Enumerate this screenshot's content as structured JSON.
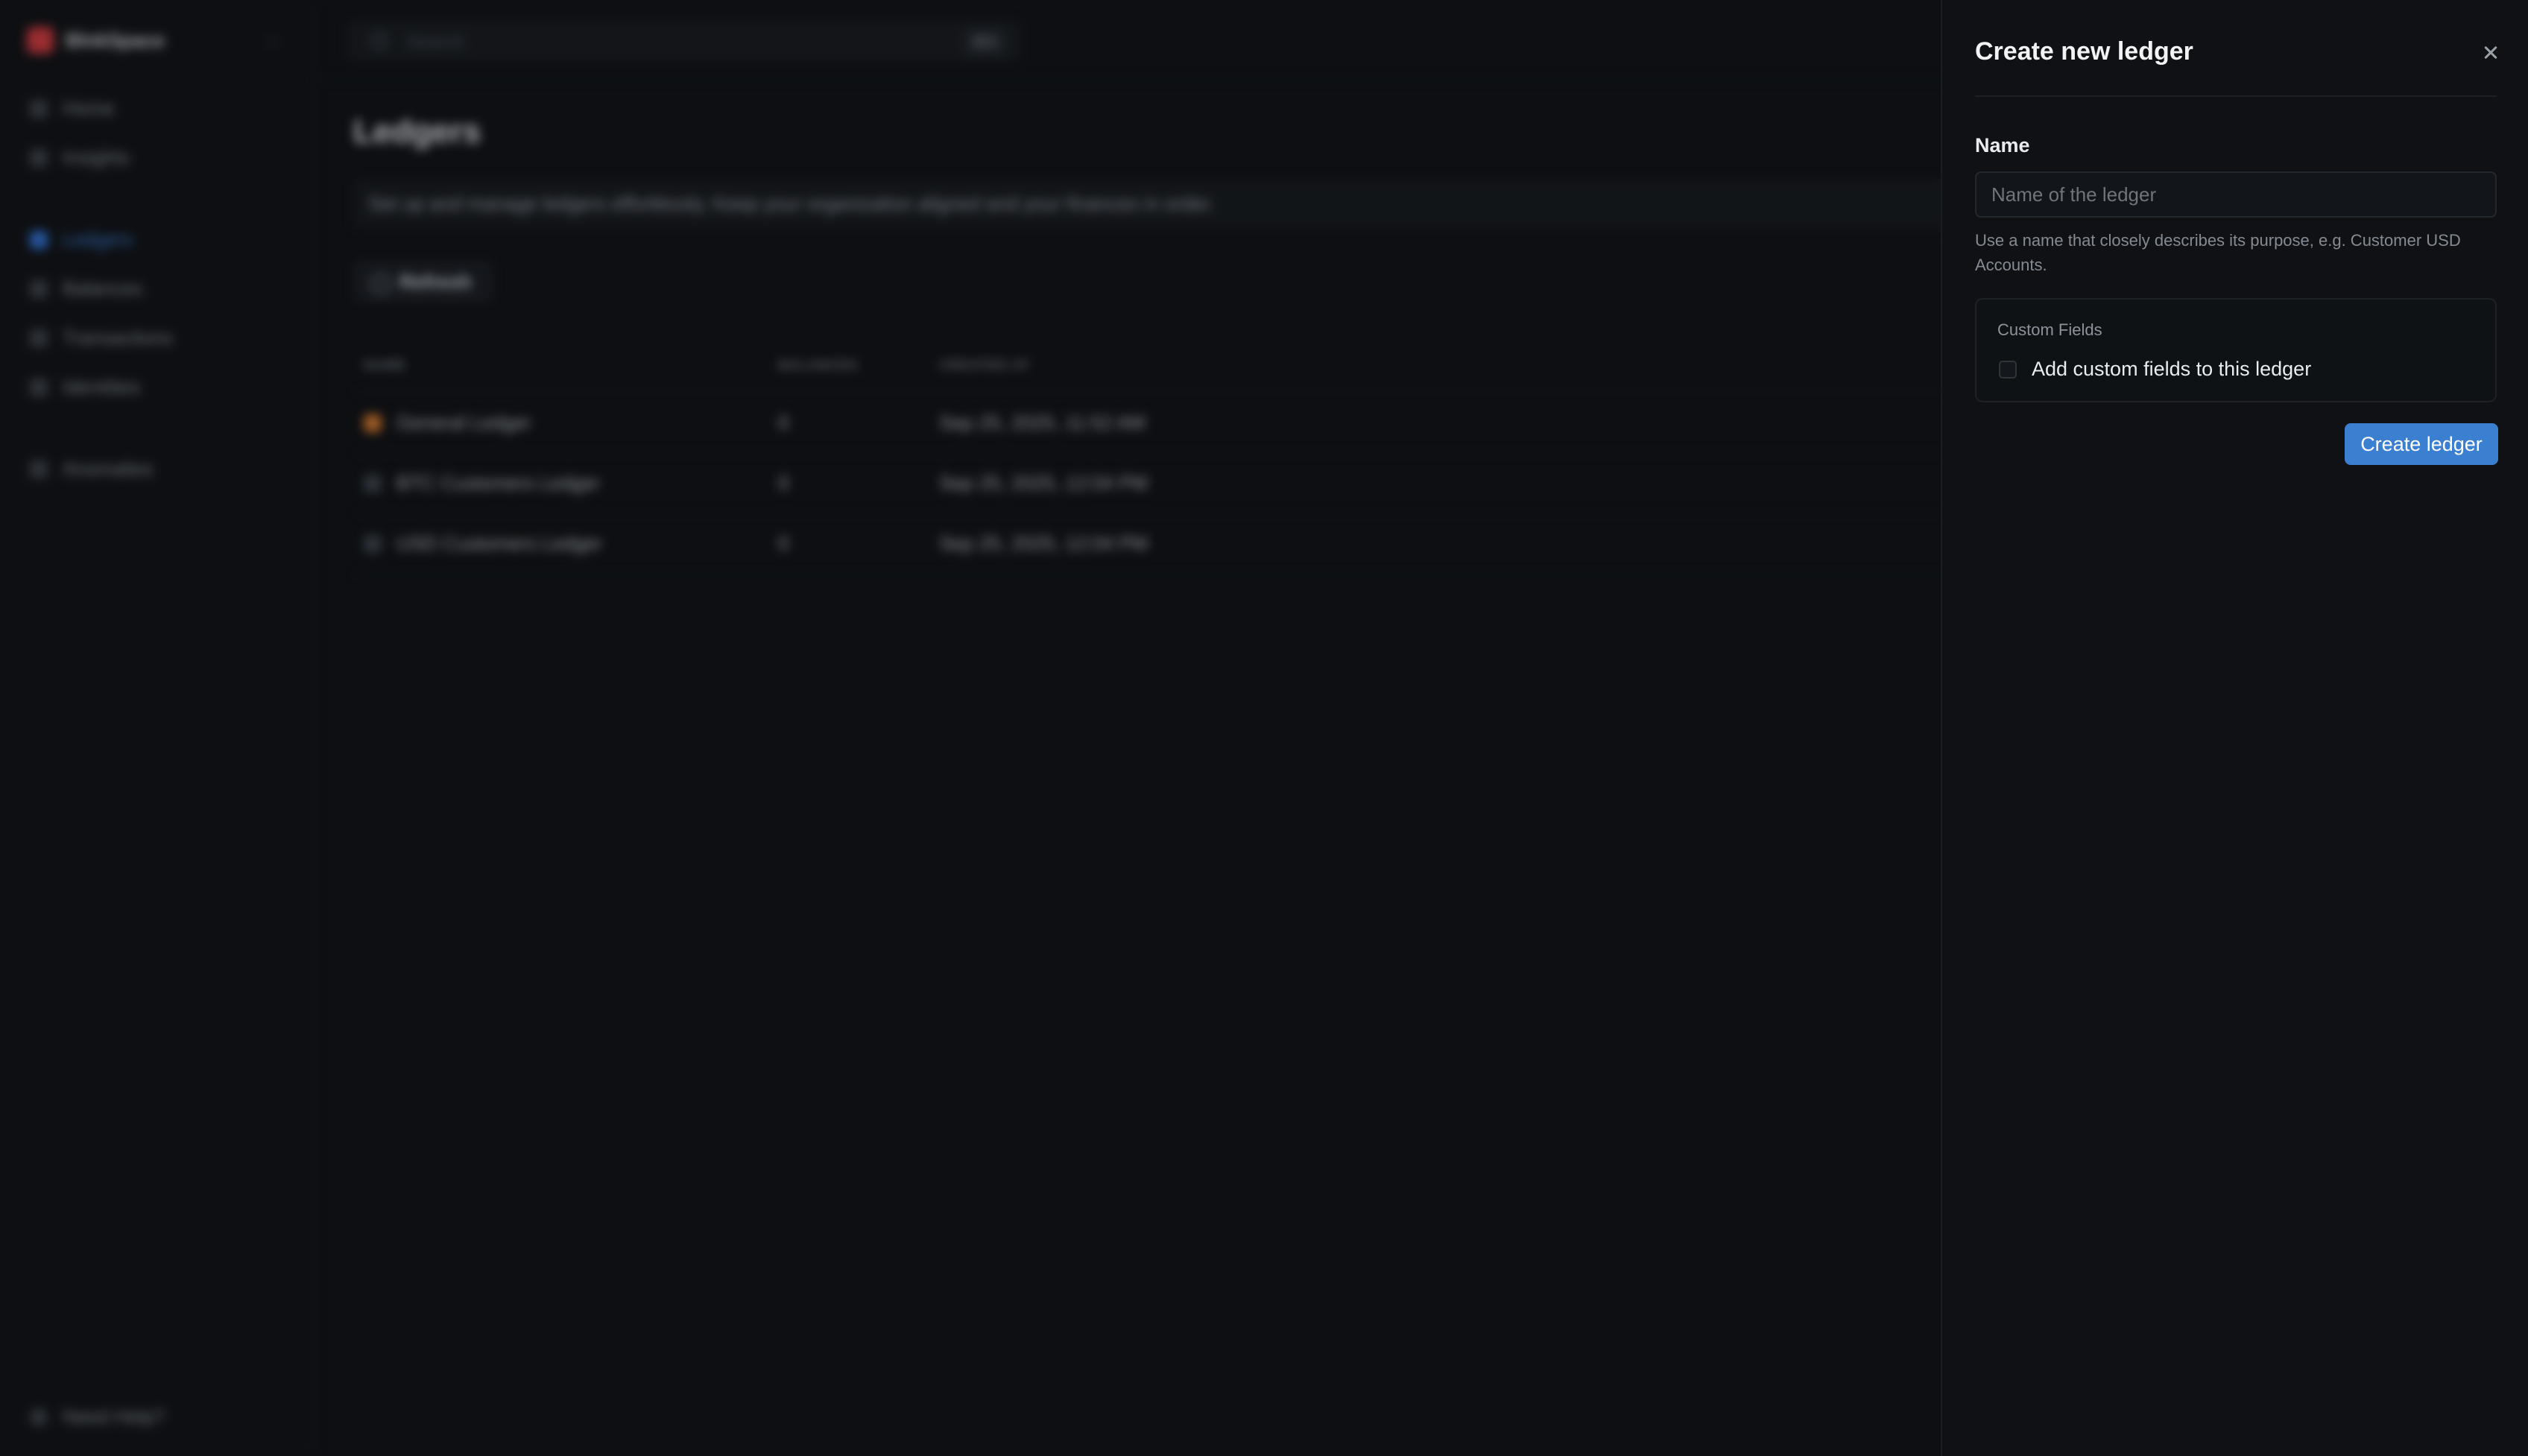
{
  "sidebar": {
    "workspace_name": "BlnkSpace",
    "items": [
      {
        "label": "Home"
      },
      {
        "label": "Insights"
      },
      {
        "label": "Ledgers"
      },
      {
        "label": "Balances"
      },
      {
        "label": "Transactions"
      },
      {
        "label": "Identities"
      },
      {
        "label": "Anomalies"
      }
    ],
    "help_label": "Need Help?"
  },
  "topbar": {
    "search_placeholder": "Search",
    "search_shortcut": "⌘K"
  },
  "main": {
    "title": "Ledgers",
    "description": "Set up and manage ledgers effortlessly. Keep your organization aligned and your finances in order.",
    "refresh_label": "Refresh",
    "table": {
      "headers": [
        "NAME",
        "BALANCES",
        "CREATED AT"
      ],
      "rows": [
        {
          "name": "General Ledger",
          "balances": "0",
          "created_at": "Sep 25, 2025, 11:52 AM"
        },
        {
          "name": "BTC Customers Ledger",
          "balances": "0",
          "created_at": "Sep 25, 2025, 12:04 PM"
        },
        {
          "name": "USD Customers Ledger",
          "balances": "0",
          "created_at": "Sep 25, 2025, 12:04 PM"
        }
      ]
    }
  },
  "drawer": {
    "title": "Create new ledger",
    "name_label": "Name",
    "name_value": "",
    "name_placeholder": "Name of the ledger",
    "hint": "Use a name that closely describes its purpose, e.g. Customer USD Accounts.",
    "custom_fields_title": "Custom Fields",
    "custom_fields_checkbox_label": "Add custom fields to this ledger",
    "custom_fields_checked": false,
    "submit_label": "Create ledger"
  },
  "colors": {
    "accent": "#3b7fd1",
    "background": "#0d0f12",
    "drawer_background": "#0f1114"
  }
}
